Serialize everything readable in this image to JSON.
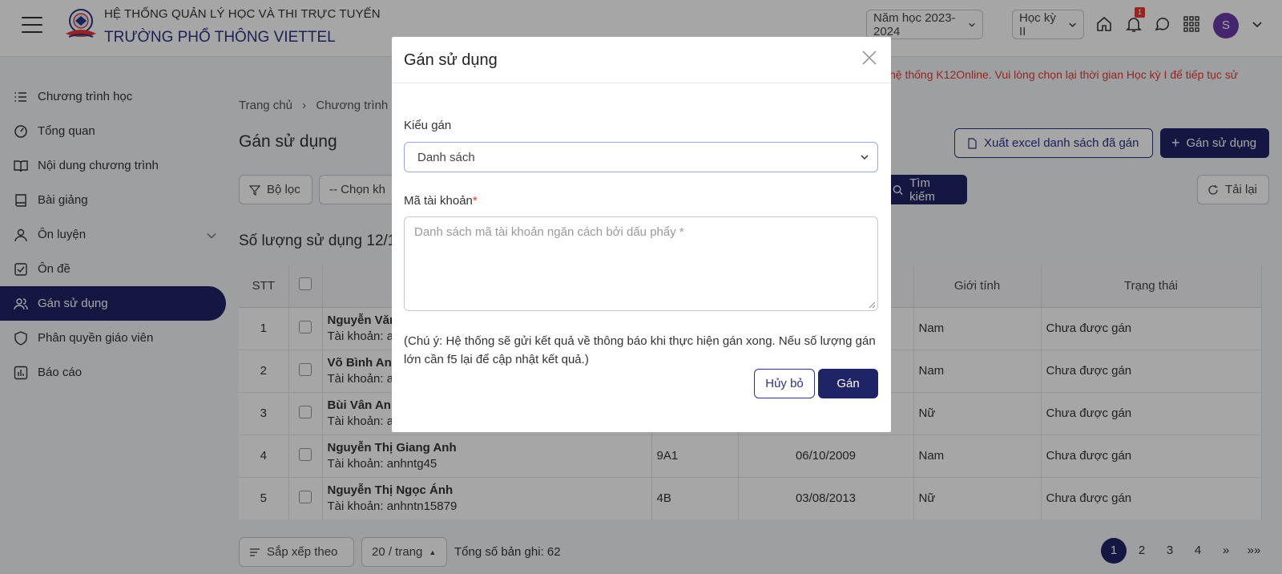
{
  "header": {
    "system_title": "HỆ THỐNG QUẢN LÝ HỌC VÀ THI TRỰC TUYẾN",
    "school_name": "TRƯỜNG PHỔ THÔNG VIETTEL",
    "school_year": "Năm học 2023-2024",
    "semester": "Học kỳ II",
    "notification_count": "1",
    "avatar_letter": "S"
  },
  "sidebar": {
    "items": [
      {
        "label": "Chương trình học",
        "icon": "list-icon"
      },
      {
        "label": "Tổng quan",
        "icon": "gauge-icon"
      },
      {
        "label": "Nội dung chương trình",
        "icon": "book-open-icon"
      },
      {
        "label": "Bài giảng",
        "icon": "book-icon"
      },
      {
        "label": "Ôn luyện",
        "icon": "user-icon"
      },
      {
        "label": "Ôn đề",
        "icon": "checkbox-icon"
      },
      {
        "label": "Gán sử dụng",
        "icon": "users-icon"
      },
      {
        "label": "Phân quyền giáo viên",
        "icon": "shield-icon"
      },
      {
        "label": "Báo cáo",
        "icon": "chart-icon"
      }
    ]
  },
  "main": {
    "warning": "hệ thống K12Online. Vui lòng chọn lại thời gian Học kỳ I để tiếp tục sử",
    "breadcrumb": {
      "home": "Trang chủ",
      "current": "Chương trình"
    },
    "page_title": "Gán sử dụng",
    "export_button": "Xuất excel danh sách đã gán",
    "assign_button": "Gán sử dụng",
    "filter_button": "Bộ lọc",
    "select_placeholder": "-- Chọn kh",
    "search_button": "Tìm kiếm",
    "reload_button": "Tải lại",
    "count_title": "Số lượng sử dụng 12/1",
    "table": {
      "headers": {
        "stt": "STT",
        "gender": "Giới tính",
        "status": "Trạng thái"
      },
      "rows": [
        {
          "stt": "1",
          "name": "Nguyễn Văn",
          "account": "Tài khoản: a",
          "class": "",
          "dob": "",
          "gender": "Nam",
          "status": "Chưa được gán"
        },
        {
          "stt": "2",
          "name": "Võ Bình An",
          "account": "Tài khoản: a",
          "class": "",
          "dob": "",
          "gender": "Nam",
          "status": "Chưa được gán"
        },
        {
          "stt": "3",
          "name": "Bùi Vân Anh",
          "account": "Tài khoản: a",
          "class": "",
          "dob": "",
          "gender": "Nữ",
          "status": "Chưa được gán"
        },
        {
          "stt": "4",
          "name": "Nguyễn Thị Giang Anh",
          "account": "Tài khoản: anhntg45",
          "class": "9A1",
          "dob": "06/10/2009",
          "gender": "Nam",
          "status": "Chưa được gán"
        },
        {
          "stt": "5",
          "name": "Nguyễn Thị Ngọc Ánh",
          "account": "Tài khoản: anhntn15879",
          "class": "4B",
          "dob": "03/08/2013",
          "gender": "Nữ",
          "status": "Chưa được gán"
        }
      ]
    },
    "footer": {
      "sort_button": "Sắp xếp theo",
      "page_size": "20 / trang",
      "total": "Tổng số bản ghi: 62",
      "pages": [
        "1",
        "2",
        "3",
        "4"
      ],
      "next": "»",
      "last": "»»"
    }
  },
  "modal": {
    "title": "Gán sử dụng",
    "type_label": "Kiểu gán",
    "type_value": "Danh sách",
    "account_label": "Mã tài khoản",
    "required_mark": "*",
    "account_placeholder": "Danh sách mã tài khoản ngăn cách bởi dấu phẩy *",
    "note": "(Chú ý: Hệ thống sẽ gửi kết quả về thông báo khi thực hiện gán xong. Nếu số lượng gán lớn cần f5 lại để cập nhật kết quả.)",
    "cancel_button": "Hủy bỏ",
    "submit_button": "Gán"
  },
  "colors": {
    "primary": "#1f2466",
    "danger": "#e23a3a",
    "avatar": "#6b3aa8"
  }
}
